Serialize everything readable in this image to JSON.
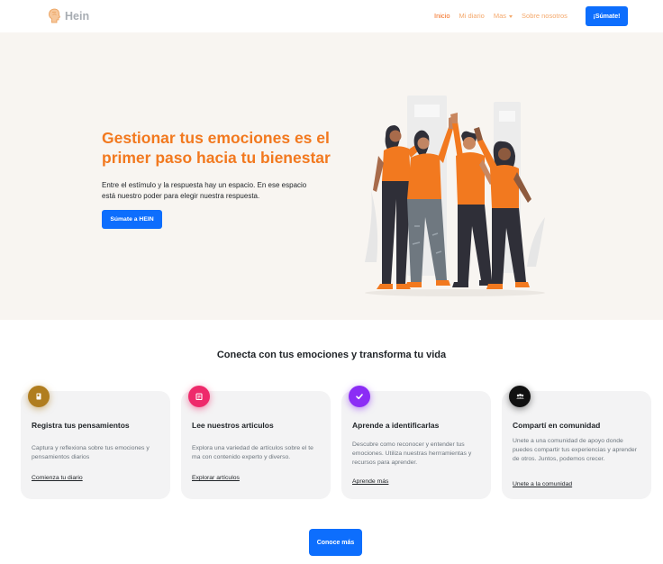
{
  "navbar": {
    "brand": "Hein",
    "links": [
      "Inicio",
      "Mi diario",
      "Mas",
      "Sobre nosotros"
    ],
    "join_label": "¡Súmate!"
  },
  "hero": {
    "title": "Gestionar tus emociones es el primer paso hacia tu bienestar",
    "subtitle": "Entre el estímulo y la respuesta hay un espacio. En ese espacio está nuestro poder para elegir nuestra respuesta.",
    "cta_label": "Súmate a HEIN"
  },
  "section": {
    "title": "Conecta con tus emociones y transforma tu vida",
    "cards": [
      {
        "icon": "notebook-icon",
        "color": "#b07d1f",
        "title": "Registra tus pensamientos",
        "text": "Captura y reflexiona sobre tus emociones y pensamientos diarios",
        "link": "Comienza tu diario"
      },
      {
        "icon": "article-icon",
        "color": "#ee2a6b",
        "title": "Lee nuestros articulos",
        "text": "Explora una variedad de artículos sobre el te ma con contenido experto y diverso.",
        "link": "Explorar artículos"
      },
      {
        "icon": "check-icon",
        "color": "#8b2cf5",
        "title": "Aprende a identificarlas",
        "text": "Descubre como reconocer y entender tus emociones. Utiliza nuestras herrramientas y recursos para aprender.",
        "link": "Aprende más"
      },
      {
        "icon": "community-icon",
        "color": "#111111",
        "title": "Compartí en comunidad",
        "text": "Unete a una comunidad de apoyo donde puedes compartir tus experiencias y aprender de otros. Juntos, podemos crecer.",
        "link": "Unete a la comunidad"
      }
    ],
    "more_label": "Conoce más"
  },
  "colors": {
    "accent": "#f2791f",
    "primary": "#0d6efd",
    "hero_bg": "#f8f5f1"
  }
}
